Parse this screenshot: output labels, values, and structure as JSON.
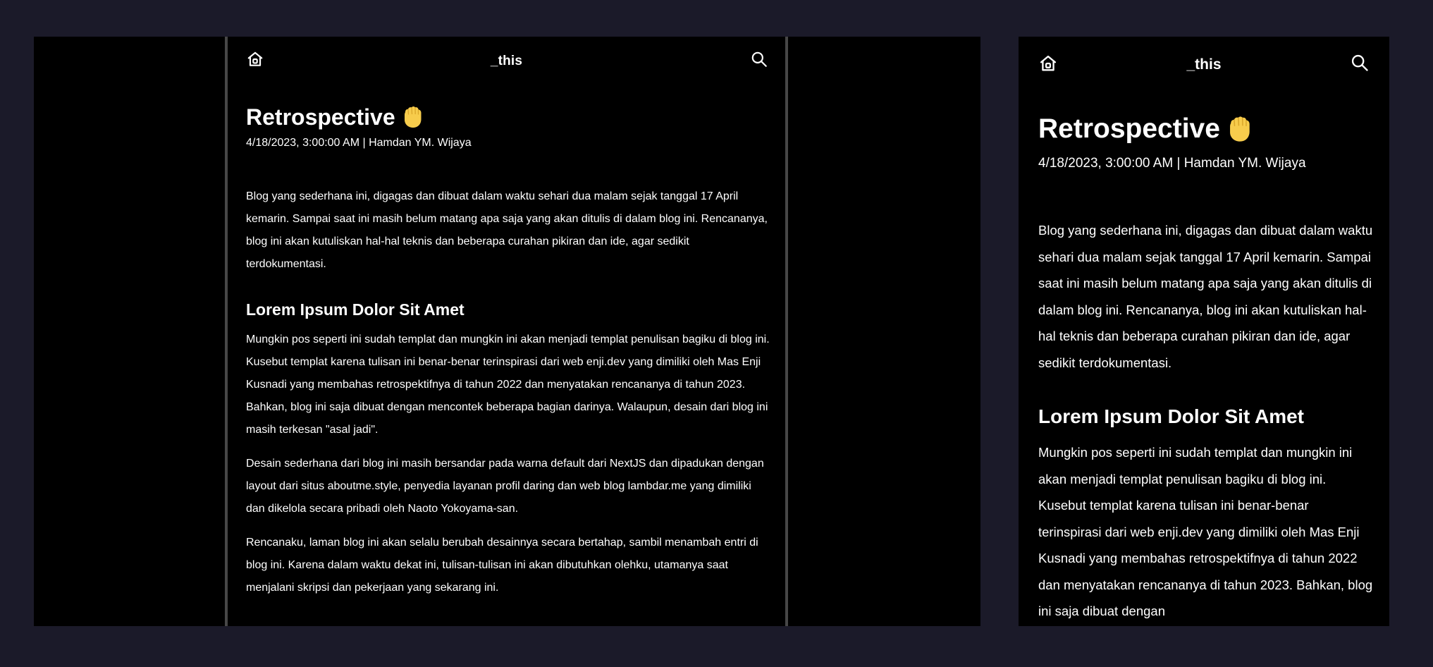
{
  "site": {
    "brand": "_this"
  },
  "nav": {
    "home_icon": "home-icon",
    "search_icon": "search-icon"
  },
  "post": {
    "title": "Retrospective",
    "title_emoji": "raised-fist-emoji",
    "meta": "4/18/2023, 3:00:00 AM | Hamdan YM. Wijaya",
    "lead": "Blog yang sederhana ini, digagas dan dibuat dalam waktu sehari dua malam sejak tanggal 17 April kemarin. Sampai saat ini masih belum matang apa saja yang akan ditulis di dalam blog ini. Rencananya, blog ini akan kutuliskan hal-hal teknis dan beberapa curahan pikiran dan ide, agar sedikit terdokumentasi.",
    "heading": "Lorem Ipsum Dolor Sit Amet",
    "paragraphs": [
      "Mungkin pos seperti ini sudah templat dan mungkin ini akan menjadi templat penulisan bagiku di blog ini. Kusebut templat karena tulisan ini benar-benar terinspirasi dari web enji.dev yang dimiliki oleh Mas Enji Kusnadi yang membahas retrospektifnya di tahun 2022 dan menyatakan rencananya di tahun 2023. Bahkan, blog ini saja dibuat dengan mencontek beberapa bagian darinya. Walaupun, desain dari blog ini masih terkesan \"asal jadi\".",
      "Desain sederhana dari blog ini masih bersandar pada warna default dari NextJS dan dipadukan dengan layout dari situs aboutme.style, penyedia layanan profil daring dan web blog lambdar.me yang dimiliki dan dikelola secara pribadi oleh Naoto Yokoyama-san.",
      "Rencanaku, laman blog ini akan selalu berubah desainnya secara bertahap, sambil menambah entri di blog ini. Karena dalam waktu dekat ini, tulisan-tulisan ini akan dibutuhkan olehku, utamanya saat menjalani skripsi dan pekerjaan yang sekarang ini."
    ]
  },
  "mobile_view": {
    "paragraph_1_visible": "Mungkin pos seperti ini sudah templat dan mungkin ini akan menjadi templat penulisan bagiku di blog ini. Kusebut templat karena tulisan ini benar-benar terinspirasi dari web enji.dev yang dimiliki oleh Mas Enji Kusnadi yang membahas retrospektifnya di tahun 2022 dan menyatakan rencananya di tahun 2023. Bahkan, blog ini saja dibuat dengan"
  },
  "colors": {
    "outer_background": "#1b1a29",
    "page_background": "#000000",
    "column_border": "#474747",
    "text": "#ffffff",
    "emoji": "#f7cc4c"
  }
}
